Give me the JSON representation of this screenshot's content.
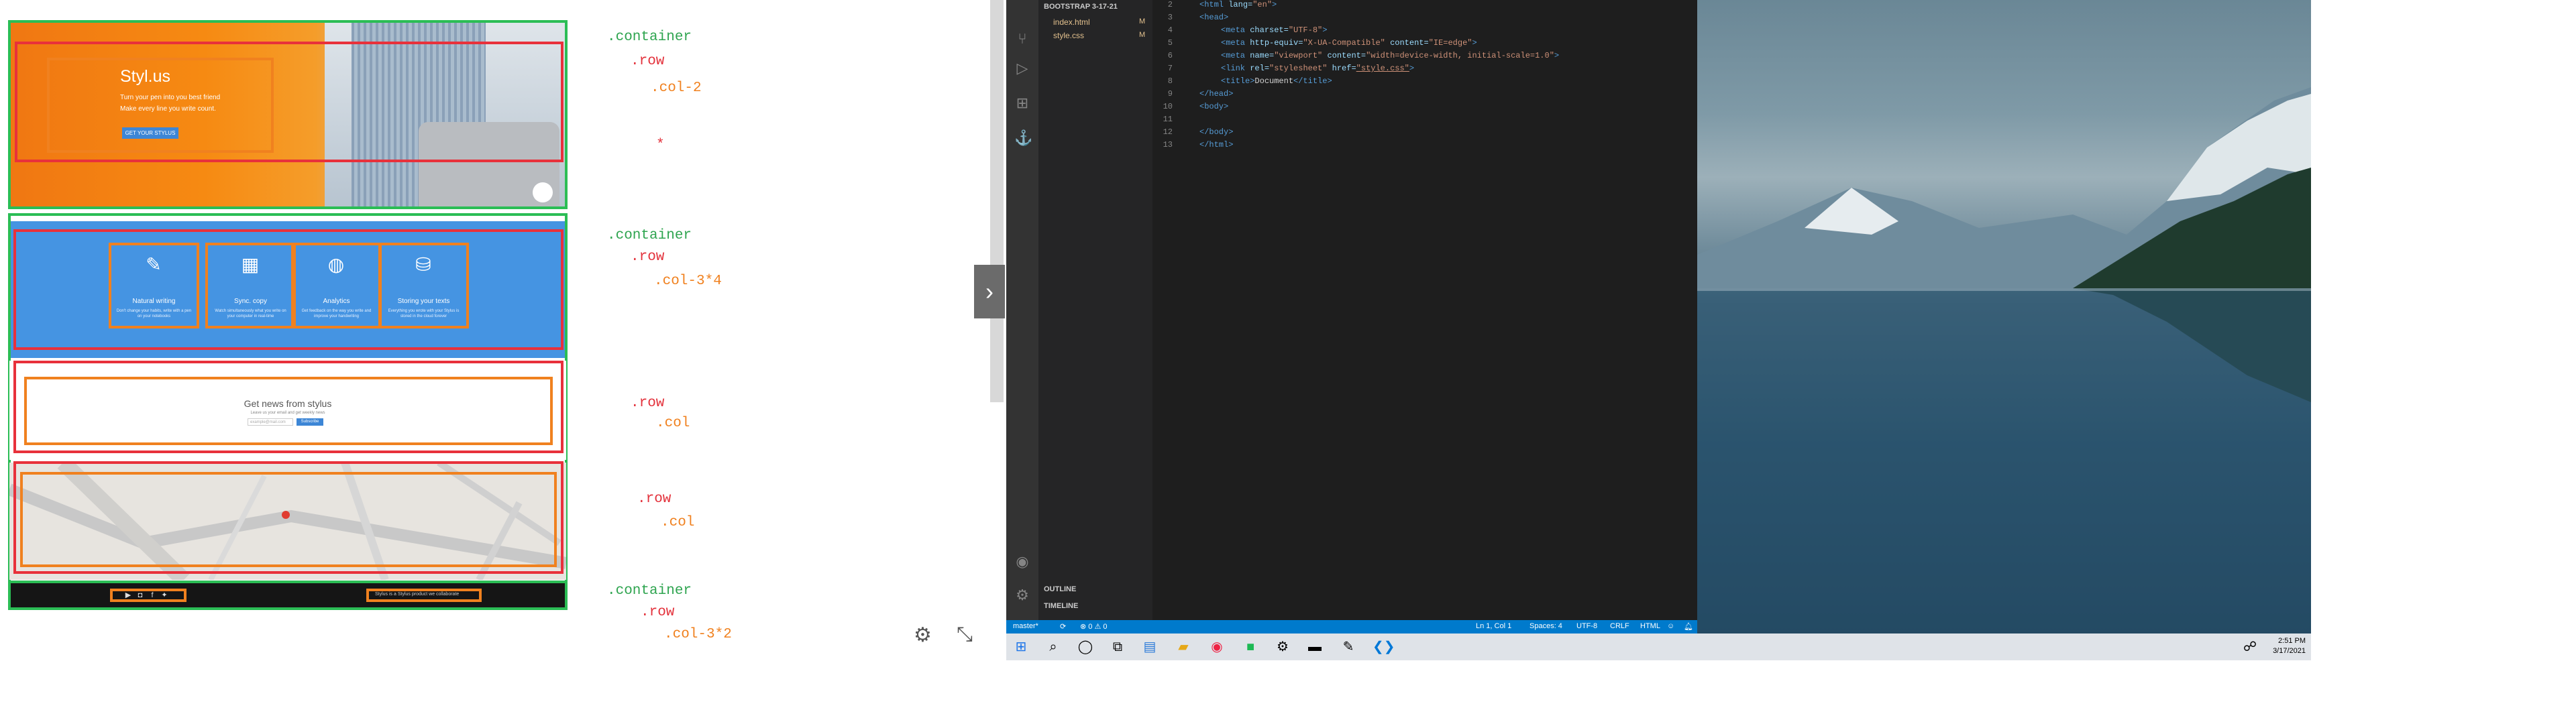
{
  "viewer": {
    "hero": {
      "title": "Styl.us",
      "line1": "Turn your pen into you best friend",
      "line2": "Make every line you write count.",
      "button": "GET YOUR STYLUS"
    },
    "features": [
      {
        "icon": "pencil-icon",
        "title": "Natural writing",
        "desc": "Don't change your habits, write with a pen on your notebooks"
      },
      {
        "icon": "layout-icon",
        "title": "Sync. copy",
        "desc": "Watch simultaneously what you write on your computer in real-time"
      },
      {
        "icon": "analytics-icon",
        "title": "Analytics",
        "desc": "Get feedback on the way you write and improve your handwriting"
      },
      {
        "icon": "database-icon",
        "title": "Storing your texts",
        "desc": "Everything you wrote with your Stylus is stored in the cloud forever"
      }
    ],
    "news": {
      "title": "Get news from stylus",
      "subtitle": "Leave us your email and get weekly news",
      "placeholder": "example@mail.com",
      "button": "Subscribe"
    },
    "footer": {
      "social": [
        "youtube-icon",
        "instagram-icon",
        "facebook-icon",
        "twitter-icon"
      ],
      "text": "Stylus is a Stylus product we collaborate"
    },
    "annotations": {
      "a1": ".container",
      "a2": ".row",
      "a3": ".col-2",
      "a4": "*",
      "b1": ".container",
      "b2": ".row",
      "b3": ".col-3*4",
      "c1": ".row",
      "c2": ".col",
      "d1": ".row",
      "d2": ".col",
      "e1": ".container",
      "e2": ".row",
      "e3": ".col-3*2"
    },
    "tools": {
      "settings": "gear-icon",
      "minimize": "collapse-icon"
    }
  },
  "vscode": {
    "explorer_title": "BOOTSTRAP 3-17-21",
    "files": [
      {
        "name": "index.html",
        "badge": "M"
      },
      {
        "name": "style.css",
        "badge": "M"
      }
    ],
    "outline": "OUTLINE",
    "timeline": "TIMELINE",
    "lines": [
      "2",
      "3",
      "4",
      "5",
      "6",
      "7",
      "8",
      "9",
      "10",
      "11",
      "12",
      "13"
    ],
    "code": {
      "l2a": "<html ",
      "l2b": "lang=",
      "l2c": "\"en\"",
      "l2d": ">",
      "l3": "<head>",
      "l4a": "<meta ",
      "l4b": "charset=",
      "l4c": "\"UTF-8\"",
      "l4d": ">",
      "l5a": "<meta ",
      "l5b": "http-equiv=",
      "l5c": "\"X-UA-Compatible\" ",
      "l5d": "content=",
      "l5e": "\"IE=edge\"",
      "l5f": ">",
      "l6a": "<meta ",
      "l6b": "name=",
      "l6c": "\"viewport\" ",
      "l6d": "content=",
      "l6e": "\"width=device-width, initial-scale=1.0\"",
      "l6f": ">",
      "l7a": "<link ",
      "l7b": "rel=",
      "l7c": "\"stylesheet\" ",
      "l7d": "href=",
      "l7e": "\"style.css\"",
      "l7f": ">",
      "l8a": "<title>",
      "l8b": "Document",
      "l8c": "</title>",
      "l9": "</head>",
      "l10": "<body>",
      "l12": "</body>",
      "l13": "</html>"
    },
    "status": {
      "branch": "master*",
      "errors": "⊗ 0 ⚠ 0",
      "position": "Ln 1, Col 1",
      "spaces": "Spaces: 4",
      "encoding": "UTF-8",
      "eol": "CRLF",
      "language": "HTML"
    }
  },
  "taskbar": {
    "time": "2:51 PM",
    "date": "3/17/2021"
  }
}
